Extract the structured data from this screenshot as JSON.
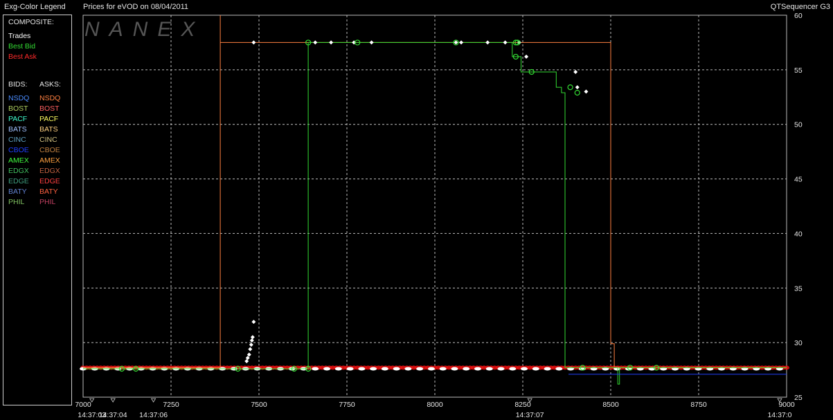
{
  "window": {
    "legend_title": "Exg-Color Legend",
    "chart_title": "Prices for  eVOD  on  08/04/2011",
    "app_name": "QTSequencer G3"
  },
  "watermark": "NANEX",
  "legend": {
    "composite_label": "COMPOSITE:",
    "composite": [
      {
        "label": "Trades",
        "color": "#ffffff"
      },
      {
        "label": "Best Bid",
        "color": "#33dd33"
      },
      {
        "label": "Best Ask",
        "color": "#ff2a2a"
      }
    ],
    "bids_label": "BIDS:",
    "asks_label": "ASKS:",
    "exchanges": [
      {
        "bid": "NSDQ",
        "bid_color": "#4a8cff",
        "ask": "NSDQ",
        "ask_color": "#ff8040"
      },
      {
        "bid": "BOST",
        "bid_color": "#b0d060",
        "ask": "BOST",
        "ask_color": "#ff6060"
      },
      {
        "bid": "PACF",
        "bid_color": "#40ffd0",
        "ask": "PACF",
        "ask_color": "#ffff60"
      },
      {
        "bid": "BATS",
        "bid_color": "#a0c0ff",
        "ask": "BATS",
        "ask_color": "#ffd080"
      },
      {
        "bid": "CINC",
        "bid_color": "#60a0c0",
        "ask": "CINC",
        "ask_color": "#d0c080"
      },
      {
        "bid": "CBOE",
        "bid_color": "#2040ff",
        "ask": "CBOE",
        "ask_color": "#c08040"
      },
      {
        "bid": "AMEX",
        "bid_color": "#40ff40",
        "ask": "AMEX",
        "ask_color": "#ffa040"
      },
      {
        "bid": "EDGX",
        "bid_color": "#40c060",
        "ask": "EDGX",
        "ask_color": "#c06040"
      },
      {
        "bid": "EDGE",
        "bid_color": "#40a080",
        "ask": "EDGE",
        "ask_color": "#ff4040"
      },
      {
        "bid": "BATY",
        "bid_color": "#6080d0",
        "ask": "BATY",
        "ask_color": "#ff6040"
      },
      {
        "bid": "PHIL",
        "bid_color": "#80c060",
        "ask": "PHIL",
        "ask_color": "#c04060"
      }
    ]
  },
  "chart_data": {
    "type": "scatter",
    "title": "Prices for  eVOD  on  08/04/2011",
    "xlim": [
      7000,
      9000
    ],
    "ylim": [
      25,
      60
    ],
    "x_ticks": [
      7000,
      7250,
      7500,
      7750,
      8000,
      8250,
      8500,
      8750,
      9000
    ],
    "y_ticks": [
      25,
      30,
      35,
      40,
      45,
      50,
      55,
      60
    ],
    "time_labels": [
      {
        "x": 7025,
        "label": "14:37:03"
      },
      {
        "x": 7085,
        "label": "14:37:04"
      },
      {
        "x": 7200,
        "label": "14:37:06"
      },
      {
        "x": 8270,
        "label": "14:37:07"
      },
      {
        "x": 8995,
        "label": "14:37:0"
      }
    ],
    "grid": true,
    "series": [
      {
        "name": "Best Ask",
        "color": "#ff8040",
        "points": [
          [
            7000,
            27.7
          ],
          [
            7390,
            27.7
          ],
          [
            7390,
            60
          ],
          [
            7390,
            57.5
          ],
          [
            8500,
            57.5
          ],
          [
            8500,
            29.9
          ],
          [
            8510,
            29.9
          ],
          [
            8510,
            27.7
          ],
          [
            9000,
            27.7
          ]
        ]
      },
      {
        "name": "Best Bid",
        "color": "#33dd33",
        "points": [
          [
            7000,
            27.6
          ],
          [
            7640,
            27.6
          ],
          [
            7640,
            57.5
          ],
          [
            8220,
            57.5
          ],
          [
            8220,
            56.2
          ],
          [
            8245,
            56.2
          ],
          [
            8245,
            54.8
          ],
          [
            8345,
            54.8
          ],
          [
            8345,
            53.4
          ],
          [
            8360,
            53.4
          ],
          [
            8360,
            52.9
          ],
          [
            8370,
            52.9
          ],
          [
            8370,
            27.7
          ],
          [
            8520,
            27.7
          ],
          [
            8520,
            26.2
          ],
          [
            8525,
            26.2
          ],
          [
            8525,
            27.7
          ],
          [
            9000,
            27.7
          ]
        ]
      },
      {
        "name": "CBOE",
        "color": "#2040ff",
        "points": [
          [
            8380,
            27.1
          ],
          [
            9000,
            27.1
          ]
        ]
      }
    ],
    "trades": [
      [
        7485,
        57.5
      ],
      [
        7660,
        57.5
      ],
      [
        7705,
        57.5
      ],
      [
        7770,
        57.5
      ],
      [
        7820,
        57.5
      ],
      [
        8060,
        57.5
      ],
      [
        8075,
        57.5
      ],
      [
        8150,
        57.5
      ],
      [
        8200,
        57.5
      ],
      [
        8240,
        57.5
      ],
      [
        8260,
        56.2
      ],
      [
        8400,
        54.8
      ],
      [
        8405,
        53.4
      ],
      [
        8430,
        53.0
      ],
      [
        7465,
        28.3
      ],
      [
        7468,
        28.6
      ],
      [
        7472,
        28.9
      ],
      [
        7475,
        29.4
      ],
      [
        7478,
        29.8
      ],
      [
        7480,
        30.2
      ],
      [
        7482,
        30.5
      ],
      [
        7485,
        31.9
      ]
    ],
    "bid_markers": [
      [
        7640,
        57.5
      ],
      [
        7780,
        57.5
      ],
      [
        8060,
        57.5
      ],
      [
        8230,
        57.5
      ],
      [
        8235,
        57.5
      ],
      [
        8230,
        56.2
      ],
      [
        8275,
        54.8
      ],
      [
        8385,
        53.4
      ],
      [
        8405,
        52.9
      ],
      [
        7110,
        27.6
      ],
      [
        7150,
        27.6
      ],
      [
        7440,
        27.6
      ],
      [
        7600,
        27.6
      ],
      [
        7640,
        27.6
      ],
      [
        8420,
        27.7
      ],
      [
        8555,
        27.7
      ],
      [
        8630,
        27.7
      ]
    ],
    "ask_quotes_band": [
      7000,
      9000,
      27.7
    ],
    "bid_quotes_band": [
      7000,
      9000,
      27.6
    ]
  }
}
